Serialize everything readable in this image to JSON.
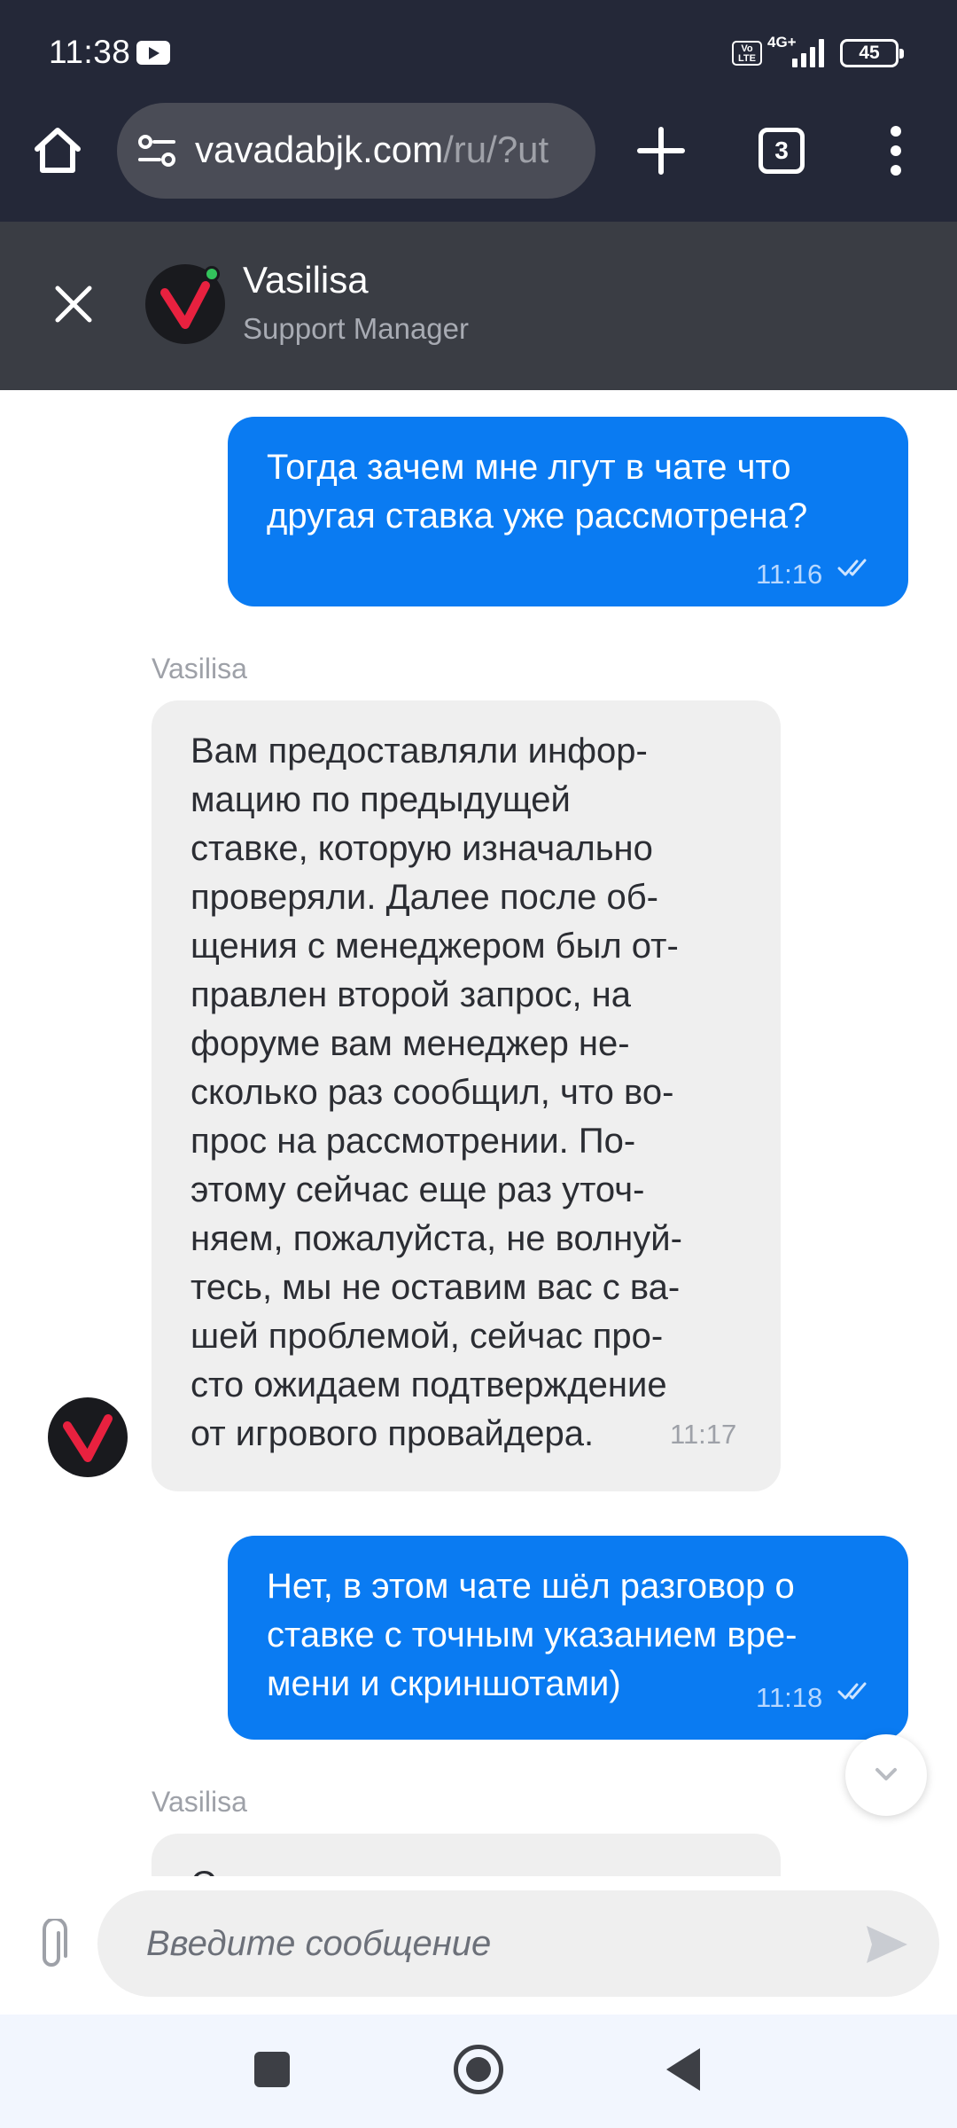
{
  "status_bar": {
    "time": "11:38",
    "network": "4G+",
    "volte": "Vo LTE",
    "battery": "45"
  },
  "browser": {
    "url_host": "vavadabjk.com",
    "url_path": "/ru/?ut",
    "tab_count": "3"
  },
  "chat_header": {
    "agent_name": "Vasilisa",
    "agent_role": "Support Manager",
    "online": true
  },
  "messages": [
    {
      "direction": "out",
      "text": "Тогда зачем мне лгут в чате что\nдругая ставка уже рассмотрена?",
      "time": "11:16",
      "read": true
    },
    {
      "direction": "in",
      "sender": "Vasilisa",
      "text": "Вам предоставляли инфор-\nмацию по предыдущей\nставке, которую изначально\nпроверяли. Далее после об-\nщения с менеджером был от-\nправлен второй запрос, на\nфоруме вам менеджер не-\nсколько раз сообщил, что во-\nпрос на рассмотрении. По-\nэтому сейчас еще раз уточ-\nняем, пожалуйста, не волнуй-\nтесь, мы не оставим вас с ва-\nшей проблемой, сейчас про-\nсто ожидаем подтверждение\nот игрового провайдера.",
      "time": "11:17"
    },
    {
      "direction": "out",
      "text": "Нет, в этом чате шёл разговор о\nставке с точным указанием вре-\nмени и скриншотами)",
      "time": "11:18",
      "read": true
    },
    {
      "direction": "in",
      "sender": "Vasilisa",
      "text": "С",
      "time": ""
    }
  ],
  "composer": {
    "placeholder": "Введите сообщение"
  },
  "colors": {
    "outgoing_bubble": "#0a7bf2",
    "incoming_bubble": "#efefef",
    "header_bg": "#3a3d44",
    "toolbar_bg": "#242838",
    "brand_red": "#e8213f",
    "online": "#33c45c"
  },
  "icons": [
    "home-icon",
    "site-settings-icon",
    "plus-icon",
    "tabs-icon",
    "more-vertical-icon",
    "close-icon",
    "vavada-logo",
    "read-ticks-icon",
    "chevron-down-icon",
    "paperclip-icon",
    "send-icon",
    "recents-icon",
    "nav-home-icon",
    "back-icon"
  ]
}
